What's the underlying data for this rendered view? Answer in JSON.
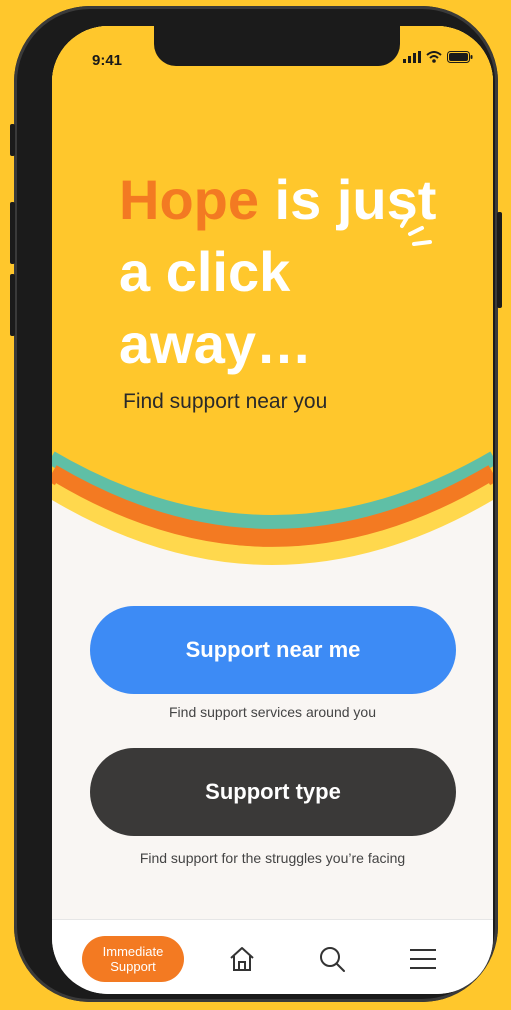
{
  "status_bar": {
    "time": "9:41"
  },
  "hero": {
    "headline_accent": "Hope",
    "headline_rest": " is just a click away…",
    "subtitle": "Find support near you"
  },
  "actions": {
    "support_near_me": {
      "label": "Support near me",
      "caption": "Find support services around you"
    },
    "support_type": {
      "label": "Support type",
      "caption": "Find support for the struggles you’re facing"
    }
  },
  "bottom_nav": {
    "immediate_support": "Immediate\nSupport",
    "icons": [
      "home-icon",
      "search-icon",
      "menu-icon"
    ]
  },
  "colors": {
    "background": "#FFC72C",
    "accent_orange": "#F37A22",
    "teal_band": "#5FBFA6",
    "primary_blue": "#3D8BF5",
    "dark_button": "#3A3938",
    "surface": "#F9F6F3"
  }
}
